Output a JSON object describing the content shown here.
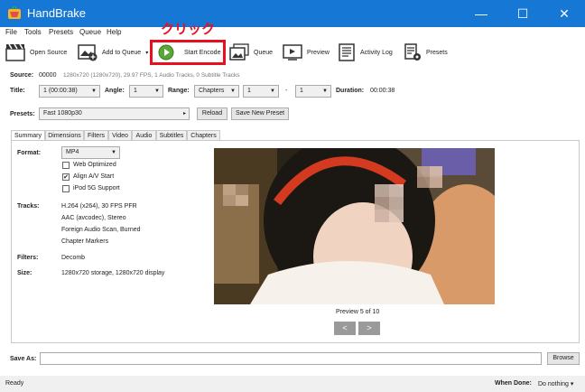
{
  "window": {
    "title": "HandBrake",
    "minimize": "—",
    "maximize": "☐",
    "close": "✕"
  },
  "menu": [
    "File",
    "Tools",
    "Presets",
    "Queue",
    "Help"
  ],
  "annotation": {
    "text": "クリック"
  },
  "toolbar": {
    "open_source": "Open Source",
    "add_to_queue": "Add to Queue",
    "add_to_queue_arrow": "▾",
    "start_encode": "Start Encode",
    "queue": "Queue",
    "preview": "Preview",
    "activity_log": "Activity Log",
    "presets": "Presets"
  },
  "source": {
    "label": "Source:",
    "id": "00000",
    "info": "1280x720 (1280x720), 29.97 FPS, 1 Audio Tracks, 0 Subtitle Tracks"
  },
  "title_row": {
    "title_label": "Title:",
    "title_value": "1 (00:00:38)",
    "angle_label": "Angle:",
    "angle_value": "1",
    "range_label": "Range:",
    "range_value": "Chapters",
    "range_start": "1",
    "range_sep": "-",
    "range_end": "1",
    "duration_label": "Duration:",
    "duration_value": "00:00:38"
  },
  "presets_row": {
    "label": "Presets:",
    "value": "Fast 1080p30",
    "arrow": "▸",
    "reload": "Reload",
    "save_new": "Save New Preset"
  },
  "tabs": [
    "Summary",
    "Dimensions",
    "Filters",
    "Video",
    "Audio",
    "Subtitles",
    "Chapters"
  ],
  "summary": {
    "format_label": "Format:",
    "format_value": "MP4",
    "web_optimized": "Web Optimized",
    "align_av": "Align A/V Start",
    "ipod": "iPod 5G Support",
    "tracks_label": "Tracks:",
    "tracks": [
      "H.264 (x264), 30 FPS PFR",
      "AAC (avcodec), Stereo",
      "Foreign Audio Scan, Burned",
      "Chapter Markers"
    ],
    "filters_label": "Filters:",
    "filters_value": "Decomb",
    "size_label": "Size:",
    "size_value": "1280x720 storage, 1280x720 display",
    "checked_mark": "✔"
  },
  "preview_pane": {
    "caption": "Preview 5 of 10",
    "prev": "<",
    "next": ">"
  },
  "save_as": {
    "label": "Save As:",
    "value": "",
    "browse": "Browse"
  },
  "status": {
    "text": "Ready",
    "when_done_label": "When Done:",
    "when_done_value": "Do nothing",
    "when_done_arrow": "▾"
  },
  "colors": {
    "titlebar": "#1677d4",
    "accent": "#e8101e"
  }
}
